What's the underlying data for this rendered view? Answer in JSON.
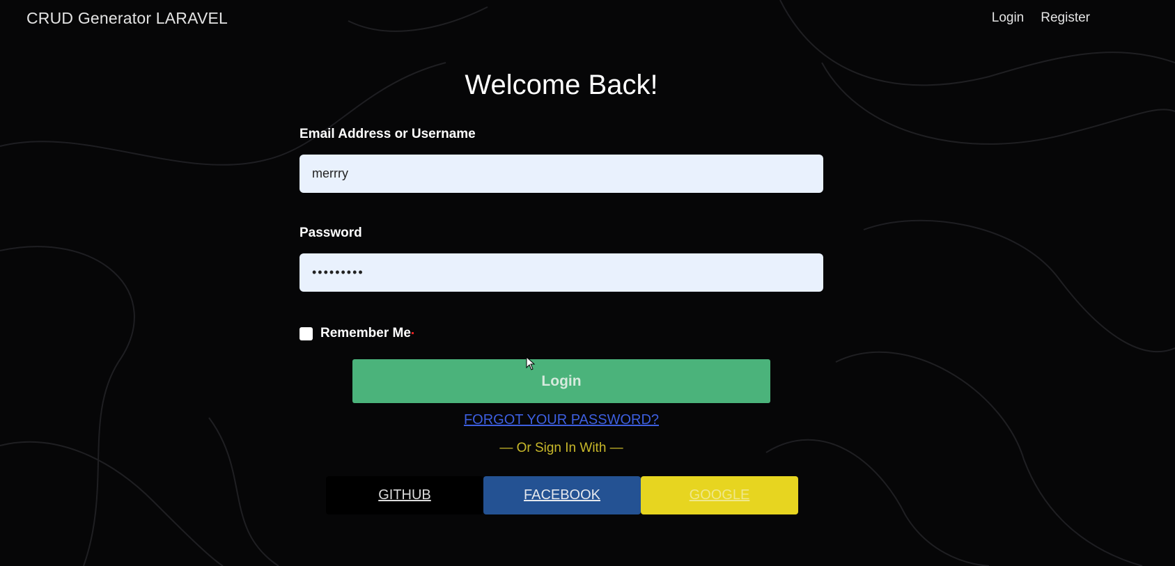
{
  "navbar": {
    "brand": "CRUD Generator LARAVEL",
    "links": [
      "Login",
      "Register"
    ]
  },
  "form": {
    "title": "Welcome Back!",
    "email_label": "Email Address or Username",
    "email_value": "merrry",
    "password_label": "Password",
    "password_value": "•••••••••",
    "remember_label": "Remember Me",
    "remember_checked": false,
    "login_button": "Login",
    "forgot_link": "FORGOT YOUR PASSWORD?",
    "or_sign_in": "— Or Sign In With —"
  },
  "social": {
    "github": "GITHUB",
    "facebook": "FACEBOOK",
    "google": "GOOGLE"
  },
  "colors": {
    "background": "#060607",
    "login_button": "#4bb37b",
    "link": "#3d5fe0",
    "or_text": "#c9b92a",
    "github": "#000000",
    "facebook": "#245293",
    "google": "#e7d520"
  }
}
